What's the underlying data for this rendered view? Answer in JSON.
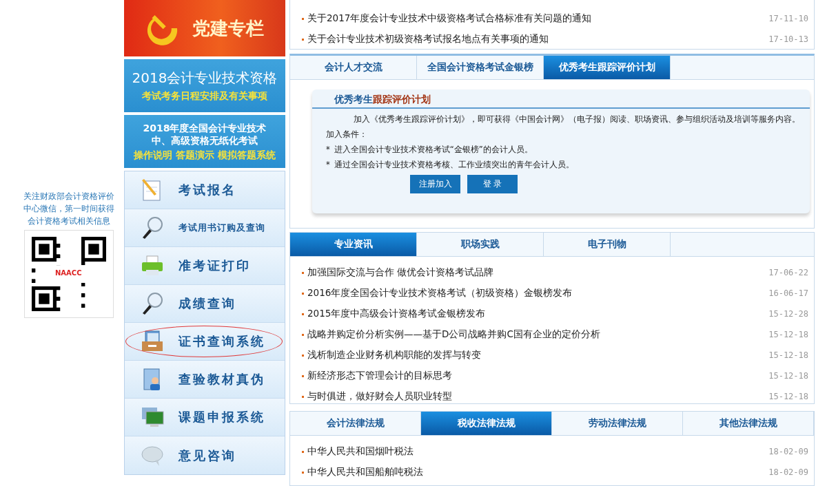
{
  "qr_panel": {
    "caption": "关注财政部会计资格评价中心微信，第一时间获得会计资格考试相关信息",
    "qr_label": "NAACC"
  },
  "banners": [
    {
      "kind": "party",
      "title": "党建专栏"
    },
    {
      "kind": "schedule",
      "title": "2018会计专业技术资格",
      "subtitle": "考试考务日程安排及有关事项"
    },
    {
      "kind": "paperless",
      "title": "2018年度全国会计专业技术中、高级资格无纸化考试",
      "subtitle": "操作说明 答题演示 模拟答题系统"
    }
  ],
  "menu": [
    {
      "label": "考试报名",
      "small": false,
      "highlighted": false
    },
    {
      "label": "考试用书订购及查询",
      "small": true,
      "highlighted": false
    },
    {
      "label": "准考证打印",
      "small": false,
      "highlighted": false
    },
    {
      "label": "成绩查询",
      "small": false,
      "highlighted": false
    },
    {
      "label": "证书查询系统",
      "small": false,
      "highlighted": true
    },
    {
      "label": "查验教材真伪",
      "small": false,
      "highlighted": false
    },
    {
      "label": "课题申报系统",
      "small": false,
      "highlighted": false
    },
    {
      "label": "意见咨询",
      "small": false,
      "highlighted": false
    }
  ],
  "notices": [
    {
      "title": "关于2017年度会计专业技术中级资格考试合格标准有关问题的通知",
      "date": "17-11-10"
    },
    {
      "title": "关于会计专业技术初级资格考试报名地点有关事项的通知",
      "date": "17-10-13"
    }
  ],
  "program_panel": {
    "tabs": [
      {
        "label": "会计人才交流",
        "selected": false
      },
      {
        "label": "全国会计资格考试金银榜",
        "selected": false
      },
      {
        "label": "优秀考生跟踪评价计划",
        "selected": true
      }
    ],
    "card": {
      "title_lead": "优秀考生",
      "title_rest": "跟踪评价计划",
      "intro": "加入《优秀考生跟踪评价计划》，即可获得《中国会计网》（电子报）阅读、职场资讯、参与组织活动及培训等服务内容。",
      "conditions_label": "加入条件：",
      "conditions": [
        "进入全国会计专业技术资格考试“金银榜”的会计人员。",
        "通过全国会计专业技术资格考核、工作业绩突出的青年会计人员。"
      ],
      "bullet": "*",
      "buttons": [
        "注册加入",
        "登 录"
      ]
    }
  },
  "news_panel": {
    "tabs": [
      {
        "label": "专业资讯",
        "selected": true
      },
      {
        "label": "职场实践",
        "selected": false
      },
      {
        "label": "电子刊物",
        "selected": false
      }
    ],
    "items": [
      {
        "title": "加强国际交流与合作 做优会计资格考试品牌",
        "date": "17-06-22"
      },
      {
        "title": "2016年度全国会计专业技术资格考试（初级资格）金银榜发布",
        "date": "16-06-17"
      },
      {
        "title": "2015年度中高级会计资格考试金银榜发布",
        "date": "15-12-28"
      },
      {
        "title": "战略并购定价分析实例——基于D公司战略并购C国有企业的定价分析",
        "date": "15-12-18"
      },
      {
        "title": "浅析制造企业财务机构职能的发挥与转变",
        "date": "15-12-18"
      },
      {
        "title": "新经济形态下管理会计的目标思考",
        "date": "15-12-18"
      },
      {
        "title": "与时俱进，做好财会人员职业转型",
        "date": "15-12-18"
      }
    ]
  },
  "law_panel": {
    "tabs": [
      {
        "label": "会计法律法规",
        "selected": false
      },
      {
        "label": "税收法律法规",
        "selected": true
      },
      {
        "label": "劳动法律法规",
        "selected": false
      },
      {
        "label": "其他法律法规",
        "selected": false
      }
    ],
    "items": [
      {
        "title": "中华人民共和国烟叶税法",
        "date": "18-02-09"
      },
      {
        "title": "中华人民共和国船舶吨税法",
        "date": "18-02-09"
      }
    ]
  }
}
